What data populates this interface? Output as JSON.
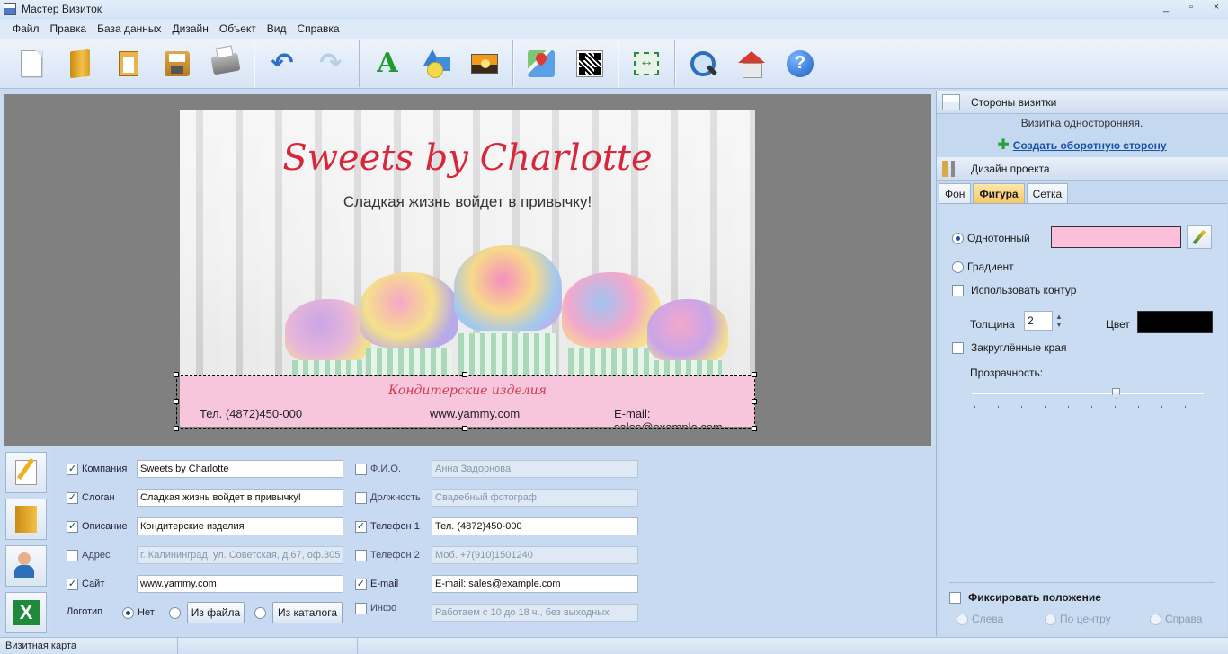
{
  "window": {
    "title": "Мастер Визиток",
    "minimize": "_",
    "maximize": "▫",
    "close": "×"
  },
  "menu": [
    "Файл",
    "Правка",
    "База данных",
    "Дизайн",
    "Объект",
    "Вид",
    "Справка"
  ],
  "toolbar": {
    "icons": [
      "new-document-icon",
      "open-folder-icon",
      "paste-icon",
      "save-icon",
      "print-icon",
      "undo-icon",
      "redo-icon",
      "add-text-icon",
      "add-shape-icon",
      "add-image-icon",
      "add-map-icon",
      "qr-code-icon",
      "fit-to-page-icon",
      "zoom-preview-icon",
      "home-icon",
      "help-icon"
    ],
    "undo_glyph": "↶",
    "redo_glyph": "↷",
    "text_glyph": "A",
    "help_glyph": "?"
  },
  "card": {
    "company": "Sweets by Charlotte",
    "slogan": "Сладкая жизнь войдет в привычку!",
    "description": "Кондитерские изделия",
    "phone": "Тел. (4872)450-000",
    "site": "www.yammy.com",
    "email": "E-mail: sales@example.com",
    "band_color": "#f8c6dc",
    "title_color": "#d8263b"
  },
  "form": {
    "left": [
      {
        "label": "Компания",
        "checked": true,
        "value": "Sweets by Charlotte",
        "enabled": true
      },
      {
        "label": "Слоган",
        "checked": true,
        "value": "Сладкая жизнь войдет в привычку!",
        "enabled": true
      },
      {
        "label": "Описание",
        "checked": true,
        "value": "Кондитерские изделия",
        "enabled": true
      },
      {
        "label": "Адрес",
        "checked": false,
        "value": "г. Калининград, ул. Советская, д.67, оф.305",
        "enabled": false
      },
      {
        "label": "Сайт",
        "checked": true,
        "value": "www.yammy.com",
        "enabled": true
      }
    ],
    "right": [
      {
        "label": "Ф.И.О.",
        "checked": false,
        "value": "Анна Задорнова",
        "enabled": false
      },
      {
        "label": "Должность",
        "checked": false,
        "value": "Свадебный фотограф",
        "enabled": false
      },
      {
        "label": "Телефон 1",
        "checked": true,
        "value": "Тел. (4872)450-000",
        "enabled": true
      },
      {
        "label": "Телефон 2",
        "checked": false,
        "value": "Моб. +7(910)1501240",
        "enabled": false
      },
      {
        "label": "E-mail",
        "checked": true,
        "value": "E-mail: sales@example.com",
        "enabled": true
      },
      {
        "label": "Инфо",
        "checked": false,
        "value": "Работаем с 10 до 18 ч., без выходных",
        "enabled": false
      }
    ],
    "logo": {
      "label": "Логотип",
      "none": "Нет",
      "from_file": "Из файла",
      "from_catalog": "Из каталога",
      "selected": "none"
    }
  },
  "right_panel": {
    "sides_header": "Стороны визитки",
    "sides_info": "Визитка односторонняя.",
    "sides_link": "Создать оборотную сторону",
    "design_header": "Дизайн проекта",
    "tabs": [
      {
        "label": "Фон",
        "active": false
      },
      {
        "label": "Фигура",
        "active": true
      },
      {
        "label": "Сетка",
        "active": false
      }
    ],
    "fill": {
      "solid_label": "Однотонный",
      "gradient_label": "Градиент",
      "selected": "solid",
      "solid_color": "#fbbfd9",
      "use_outline_label": "Использовать контур",
      "use_outline": false,
      "thickness_label": "Толщина",
      "thickness": "2",
      "color_label": "Цвет",
      "outline_color": "#000000",
      "rounded_label": "Закруглённые края",
      "rounded": false,
      "opacity_label": "Прозрачность:",
      "opacity_fraction": 0.62
    },
    "fix": {
      "label": "Фиксировать положение",
      "checked": false,
      "left": "Слева",
      "center": "По центру",
      "right": "Справа"
    }
  },
  "status": {
    "left": "Визитная карта",
    "middle": "",
    "right": ""
  }
}
